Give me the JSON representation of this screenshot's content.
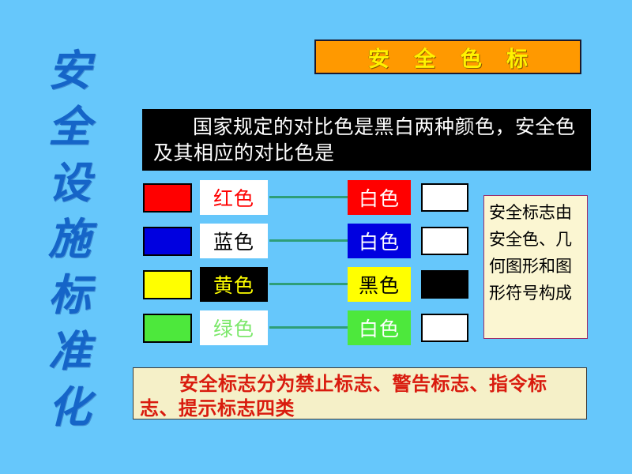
{
  "slide": {
    "background_color": "#66C7FB",
    "vertical_title": {
      "full_text": "安全设施标准化",
      "color": "#1565C8",
      "chars": [
        "安",
        "全",
        "设",
        "施",
        "标",
        "准",
        "化"
      ]
    },
    "title_banner": {
      "text": "安 全 色 标",
      "background_color": "#FF9900",
      "text_color": "#FFF200",
      "border_color": "#1A1A2E"
    },
    "statement_box": {
      "text": "国家规定的对比色是黑白两种颜色，安全色及其相应的对比色是",
      "background_color": "#000000",
      "text_color": "#FFFFFF"
    },
    "color_table": {
      "connector_color": "#2E9E78",
      "rows": [
        {
          "safety_color_swatch": "#FF0000",
          "safety_color_label": "红色",
          "safety_label_bg": "#FFFFFF",
          "safety_label_fg": "#FF0000",
          "contrast_color_label": "白色",
          "contrast_label_bg": "#FF0000",
          "contrast_label_fg": "#FFFFFF",
          "contrast_color_swatch": "#FFFFFF"
        },
        {
          "safety_color_swatch": "#0000E0",
          "safety_color_label": "蓝色",
          "safety_label_bg": "#FFFFFF",
          "safety_label_fg": "#000000",
          "contrast_color_label": "白色",
          "contrast_label_bg": "#0000E0",
          "contrast_label_fg": "#FFFFFF",
          "contrast_color_swatch": "#FFFFFF"
        },
        {
          "safety_color_swatch": "#FFFF00",
          "safety_color_label": "黄色",
          "safety_label_bg": "#000000",
          "safety_label_fg": "#FFFF00",
          "contrast_color_label": "黑色",
          "contrast_label_bg": "#FFFF00",
          "contrast_label_fg": "#000000",
          "contrast_color_swatch": "#000000"
        },
        {
          "safety_color_swatch": "#4DE83C",
          "safety_color_label": "绿色",
          "safety_label_bg": "#FFFFFF",
          "safety_label_fg": "#7CE86B",
          "contrast_color_label": "白色",
          "contrast_label_bg": "#4DE83C",
          "contrast_label_fg": "#FFFFFF",
          "contrast_color_swatch": "#FFFFFF"
        }
      ]
    },
    "side_note": {
      "text": "安全标志由安全色、几何图形和图形符号构成",
      "background_color": "#FBF6D2",
      "border_color": "#9B2D6B",
      "text_color": "#000000"
    },
    "bottom_box": {
      "text": "安全标志分为禁止标志、警告标志、指令标志、提示标志四类",
      "background_color": "#F5F0C8",
      "border_color": "#3A3A3A",
      "text_color": "#D91B0E"
    }
  }
}
